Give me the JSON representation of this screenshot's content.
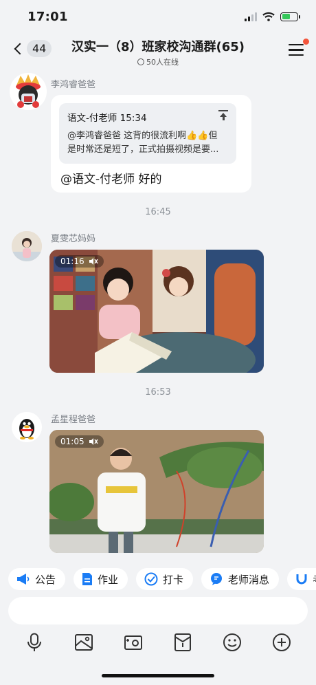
{
  "status": {
    "time": "17:01"
  },
  "header": {
    "back_count": "44",
    "title": "汉实一（8）班家校沟通群(65)",
    "online": "50人在线"
  },
  "messages": {
    "m1": {
      "sender": "李鸿睿爸爸",
      "quote_author_time": "语文-付老师 15:34",
      "quote_line1": "@李鸿睿爸爸 这背的很流利啊👍👍但",
      "quote_line2": "是时常还是短了，正式拍摄视频是要...",
      "reply": "@语文-付老师 好的"
    },
    "t1": "16:45",
    "m2": {
      "sender": "夏雯芯妈妈",
      "duration": "01:16"
    },
    "t2": "16:53",
    "m3": {
      "sender": "孟星程爸爸",
      "duration": "01:05"
    }
  },
  "quick_actions": [
    {
      "label": "公告",
      "icon": "megaphone-icon"
    },
    {
      "label": "作业",
      "icon": "document-icon"
    },
    {
      "label": "打卡",
      "icon": "check-circle-icon"
    },
    {
      "label": "老师消息",
      "icon": "chat-bubble-icon"
    },
    {
      "label": "考",
      "icon": "magnet-icon"
    }
  ],
  "input": {
    "value": ""
  },
  "toolbar": [
    "microphone-icon",
    "image-icon",
    "camera-icon",
    "red-packet-icon",
    "emoji-icon",
    "plus-icon"
  ],
  "colors": {
    "accent": "#1a7cf5",
    "background": "#f2f3f5",
    "notification": "#f3553c"
  }
}
